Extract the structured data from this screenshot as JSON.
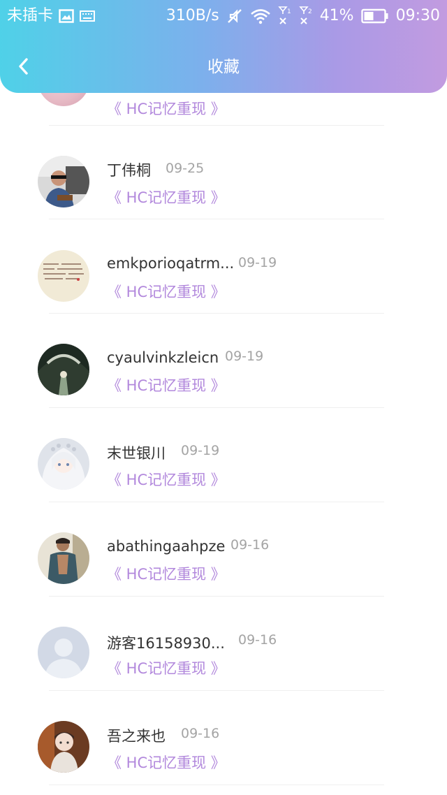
{
  "status_bar": {
    "carrier": "未插卡",
    "speed": "310B/s",
    "sim1": "1",
    "sim2": "2",
    "battery": "41%",
    "time": "09:30"
  },
  "navbar": {
    "title": "收藏",
    "back_icon": "chevron-left-icon"
  },
  "colors": {
    "header_gradient_start": "#4fd1e8",
    "header_gradient_end": "#c29be0",
    "topic_color": "#b288dc",
    "name_color": "#333333",
    "date_color": "#a4a4a4"
  },
  "partial_row": {
    "topic": "《 HC记忆重现 》"
  },
  "favorites": [
    {
      "name": "丁伟桐",
      "date": "09-25",
      "topic": "《 HC记忆重现 》"
    },
    {
      "name": "emkporioqatrm...",
      "date": "09-19",
      "topic": "《 HC记忆重现 》"
    },
    {
      "name": "cyaulvinkzleicn",
      "date": "09-19",
      "topic": "《 HC记忆重现 》"
    },
    {
      "name": "末世银川",
      "date": "09-19",
      "topic": "《 HC记忆重现 》"
    },
    {
      "name": "abathingaahpze",
      "date": "09-16",
      "topic": "《 HC记忆重现 》"
    },
    {
      "name": "游客16158930...",
      "date": "09-16",
      "topic": "《 HC记忆重现 》"
    },
    {
      "name": "吾之来也",
      "date": "09-16",
      "topic": "《 HC记忆重现 》"
    }
  ]
}
